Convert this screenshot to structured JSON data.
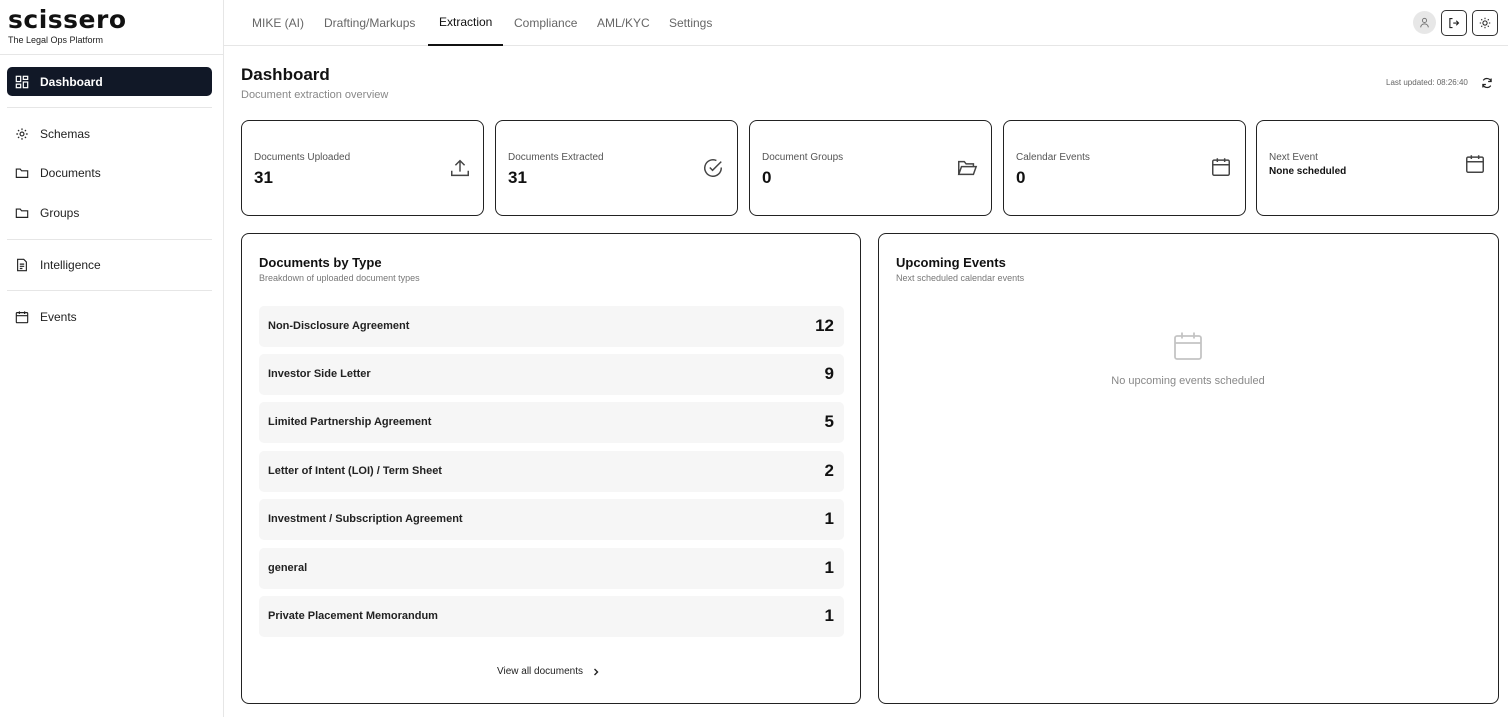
{
  "brand": {
    "name": "scissero",
    "tagline": "The Legal Ops Platform"
  },
  "sidebar": {
    "items": [
      {
        "label": "Dashboard",
        "icon": "grid-icon"
      },
      {
        "label": "Schemas",
        "icon": "gear-icon"
      },
      {
        "label": "Documents",
        "icon": "folder-icon"
      },
      {
        "label": "Groups",
        "icon": "folder-icon"
      },
      {
        "label": "Intelligence",
        "icon": "file-text-icon"
      },
      {
        "label": "Events",
        "icon": "calendar-icon"
      }
    ]
  },
  "tabs": [
    {
      "label": "MIKE (AI)"
    },
    {
      "label": "Drafting/Markups"
    },
    {
      "label": "Extraction"
    },
    {
      "label": "Compliance"
    },
    {
      "label": "AML/KYC"
    },
    {
      "label": "Settings"
    }
  ],
  "header": {
    "title": "Dashboard",
    "subtitle": "Document extraction overview",
    "last_updated": "Last updated: 08:26:40"
  },
  "stats": [
    {
      "label": "Documents Uploaded",
      "value": "31",
      "icon": "upload-icon"
    },
    {
      "label": "Documents Extracted",
      "value": "31",
      "icon": "check-circle-icon"
    },
    {
      "label": "Document Groups",
      "value": "0",
      "icon": "folder-open-icon"
    },
    {
      "label": "Calendar Events",
      "value": "0",
      "icon": "calendar-icon"
    },
    {
      "label": "Next Event",
      "value": "None scheduled",
      "icon": "calendar-icon"
    }
  ],
  "documents_by_type": {
    "title": "Documents by Type",
    "subtitle": "Breakdown of uploaded document types",
    "rows": [
      {
        "name": "Non-Disclosure Agreement",
        "count": "12"
      },
      {
        "name": "Investor Side Letter",
        "count": "9"
      },
      {
        "name": "Limited Partnership Agreement",
        "count": "5"
      },
      {
        "name": "Letter of Intent (LOI) / Term Sheet",
        "count": "2"
      },
      {
        "name": "Investment / Subscription Agreement",
        "count": "1"
      },
      {
        "name": "general",
        "count": "1"
      },
      {
        "name": "Private Placement Memorandum",
        "count": "1"
      }
    ],
    "view_all": "View all documents"
  },
  "upcoming_events": {
    "title": "Upcoming Events",
    "subtitle": "Next scheduled calendar events",
    "empty": "No upcoming events scheduled"
  }
}
